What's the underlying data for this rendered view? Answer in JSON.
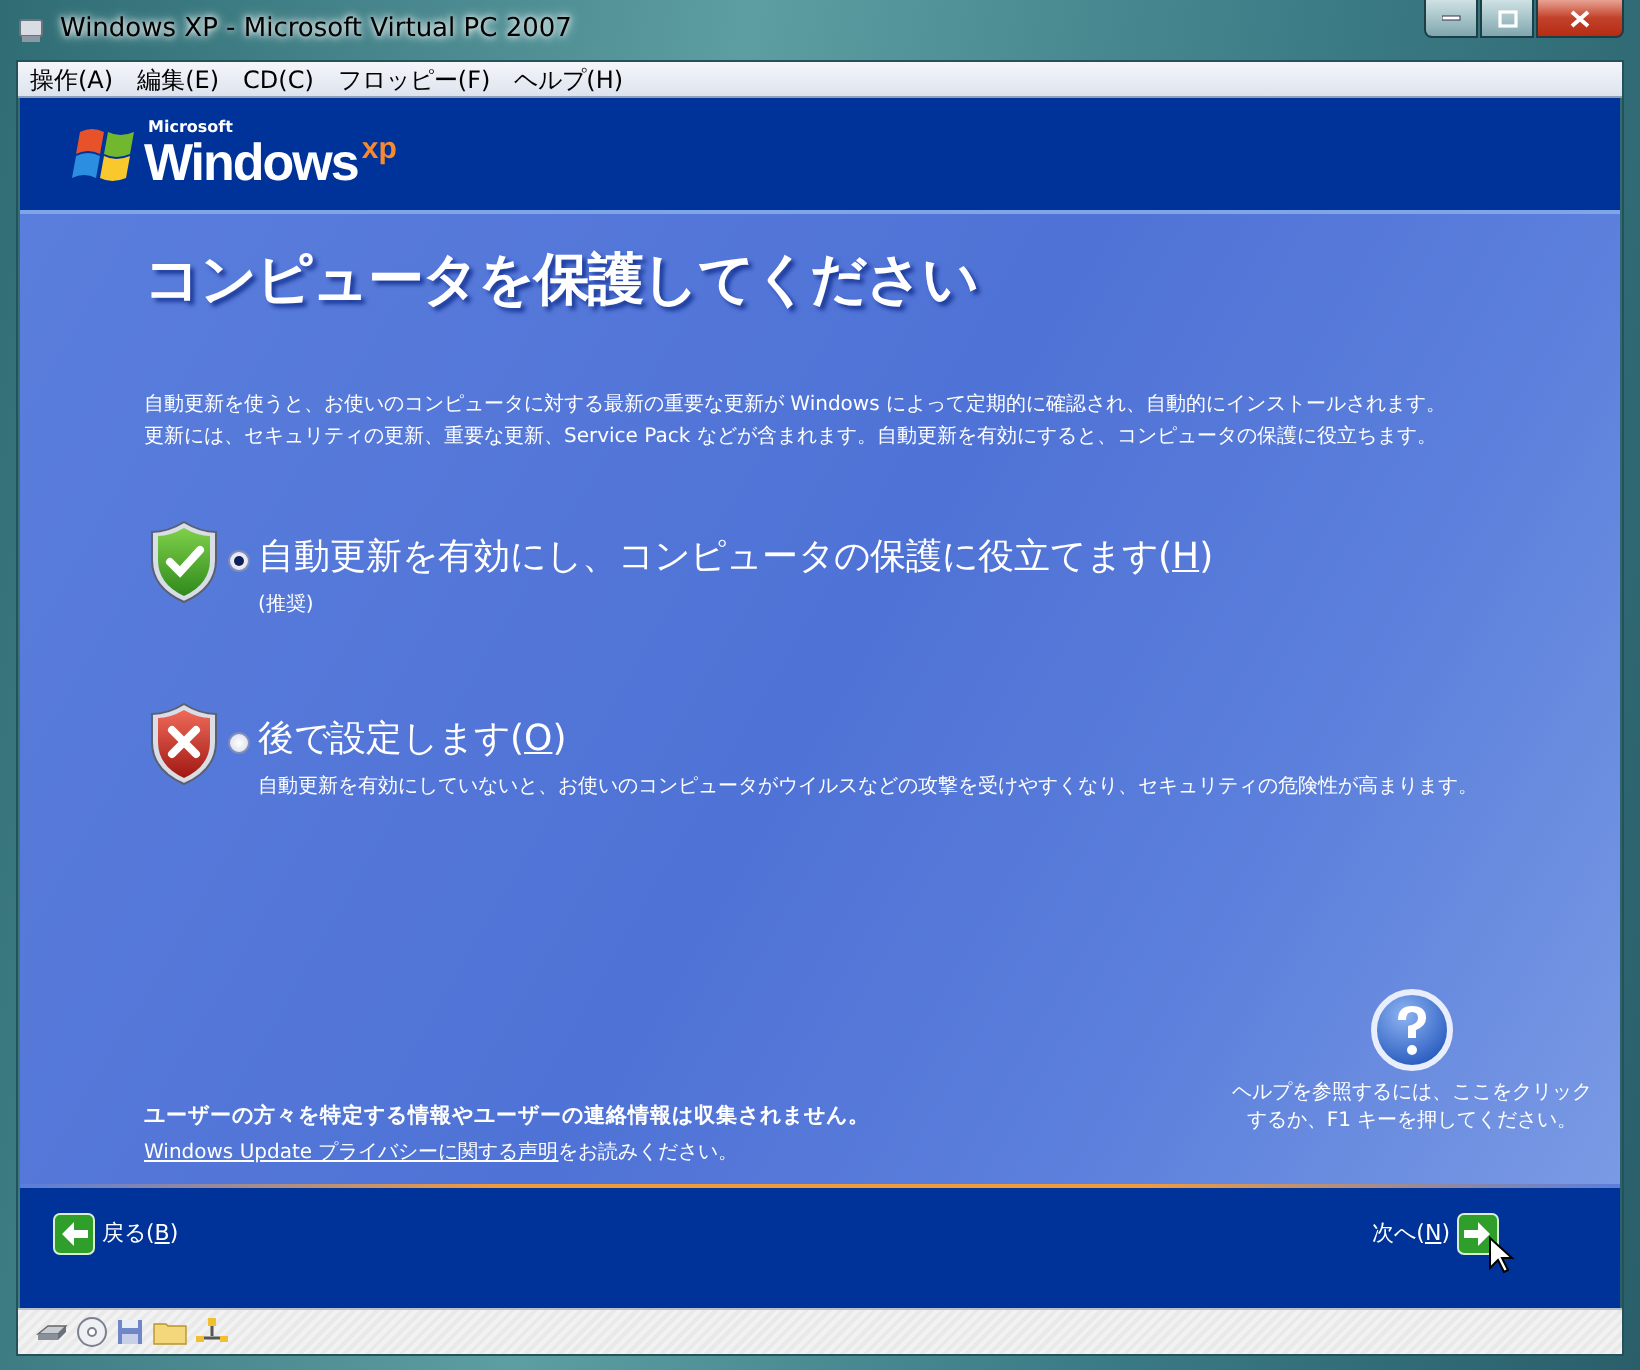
{
  "window": {
    "title": "Windows XP - Microsoft Virtual PC 2007"
  },
  "menu": [
    "操作(A)",
    "編集(E)",
    "CD(C)",
    "フロッピー(F)",
    "ヘルプ(H)"
  ],
  "logo": {
    "maker": "Microsoft",
    "name": "Windows",
    "version": "xp"
  },
  "heading": "コンピュータを保護してください",
  "intro": [
    "自動更新を使うと、お使いのコンピュータに対する最新の重要な更新が Windows によって定期的に確認され、自動的にインストールされます。",
    "更新には、セキュリティの更新、重要な更新、Service Pack などが含まれます。自動更新を有効にすると、コンピュータの保護に役立ちます。"
  ],
  "options": [
    {
      "kind": "check",
      "selected": true,
      "label_before": "自動更新を有効にし、コンピュータの保護に役立てます(",
      "accesskey": "H",
      "label_after": ")",
      "note": "(推奨)"
    },
    {
      "kind": "cross",
      "selected": false,
      "label_before": "後で設定します(",
      "accesskey": "O",
      "label_after": ")",
      "note": "自動更新を有効にしていないと、お使いのコンピュータがウイルスなどの攻撃を受けやすくなり、セキュリティの危険性が高まります。"
    }
  ],
  "privacy": {
    "notice": "ユーザーの方々を特定する情報やユーザーの連絡情報は収集されません。",
    "link": "Windows Update プライバシーに関する声明",
    "link_suffix": "をお読みください。"
  },
  "help": {
    "lines": [
      "ヘルプを参照するには、ここをクリック",
      "するか、F1 キーを押してください。"
    ]
  },
  "nav": {
    "back": {
      "before": "戻る(",
      "accesskey": "B",
      "after": ")"
    },
    "next": {
      "before": "次へ(",
      "accesskey": "N",
      "after": ")"
    }
  }
}
